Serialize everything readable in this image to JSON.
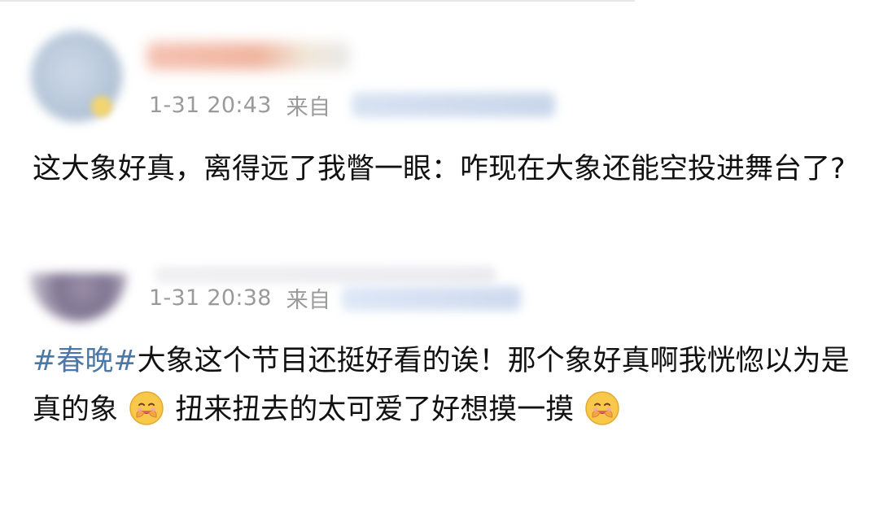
{
  "posts": [
    {
      "time": "1-31 20:43",
      "from_label": "来自",
      "text": "这大象好真，离得远了我瞥一眼：咋现在大象还能空投进舞台了?"
    },
    {
      "time": "1-31 20:38",
      "from_label": "来自",
      "hashtag": "#春晚#",
      "text_1": "大象这个节目还挺好看的诶！那个象好真啊我恍惚以为是真的象",
      "emoji_1": "hugging-face-emoji",
      "text_2": "扭来扭去的太可爱了好想摸一摸",
      "emoji_2": "hugging-face-emoji"
    }
  ],
  "colors": {
    "hashtag": "#4c78a8",
    "meta": "#9a9a9a",
    "text": "#111111"
  }
}
